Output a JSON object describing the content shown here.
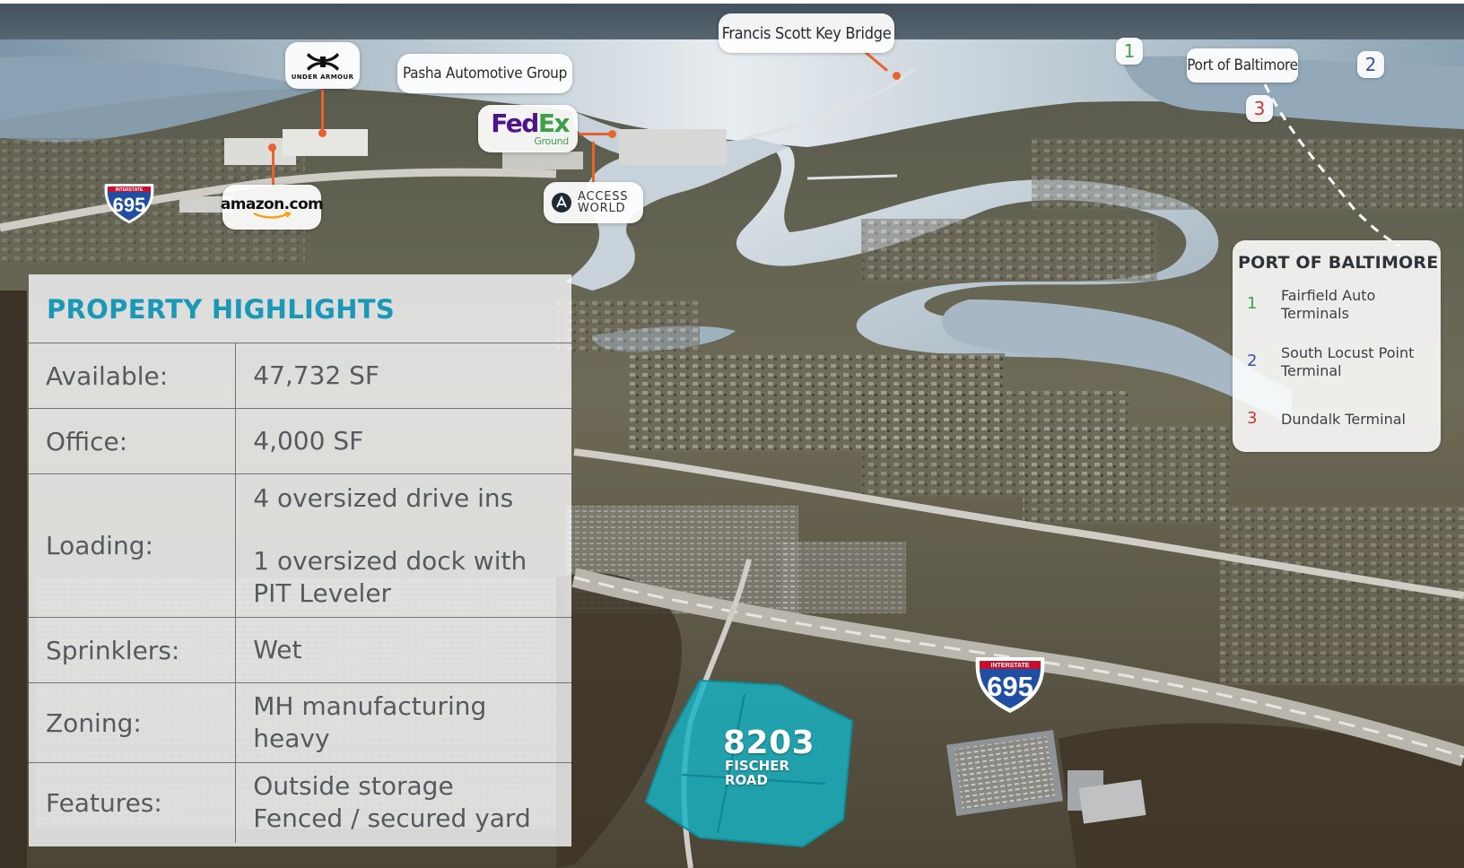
{
  "map_labels": {
    "key_bridge": "Francis Scott Key Bridge",
    "port_label": "Port of Baltimore",
    "pasha": "Pasha Automotive Group",
    "under_armour_text": "UNDER ARMOUR",
    "amazon": "amazon.com",
    "fedex_fed": "Fed",
    "fedex_ex": "Ex",
    "fedex_ground": "Ground",
    "access_world_line1": "ACCESS",
    "access_world_line2": "WORLD",
    "badges": [
      "1",
      "2",
      "3"
    ]
  },
  "shields": {
    "top_text": "INTERSTATE",
    "number": "695"
  },
  "highlights": {
    "title": "PROPERTY HIGHLIGHTS",
    "rows": [
      {
        "label": "Available:",
        "value": "47,732 SF"
      },
      {
        "label": "Office:",
        "value": "4,000 SF"
      },
      {
        "label": "Loading:",
        "value": "4 oversized drive ins",
        "value2": "1 oversized dock with PIT Leveler"
      },
      {
        "label": "Sprinklers:",
        "value": "Wet"
      },
      {
        "label": "Zoning:",
        "value": "MH manufacturing heavy"
      },
      {
        "label": "Features:",
        "value": "Outside storage",
        "value2": "Fenced / secured yard"
      }
    ]
  },
  "port_legend": {
    "title": "PORT OF BALTIMORE",
    "items": [
      {
        "num": "1",
        "name": "Fairfield Auto Terminals",
        "color": "#3fa34d"
      },
      {
        "num": "2",
        "name": "South Locust Point Terminal",
        "color": "#3b4fa8"
      },
      {
        "num": "3",
        "name": "Dundalk Terminal",
        "color": "#d0343a"
      }
    ]
  },
  "property": {
    "number": "8203",
    "street": "FISCHER ROAD",
    "highlight_color": "#16b3c4"
  },
  "colors": {
    "accent": "#1a98b8",
    "leader": "#e8622c",
    "fedex_purple": "#4d148c",
    "fedex_orange": "#ff6200",
    "shield_blue": "#1f4ea3",
    "shield_red": "#c8102e"
  }
}
